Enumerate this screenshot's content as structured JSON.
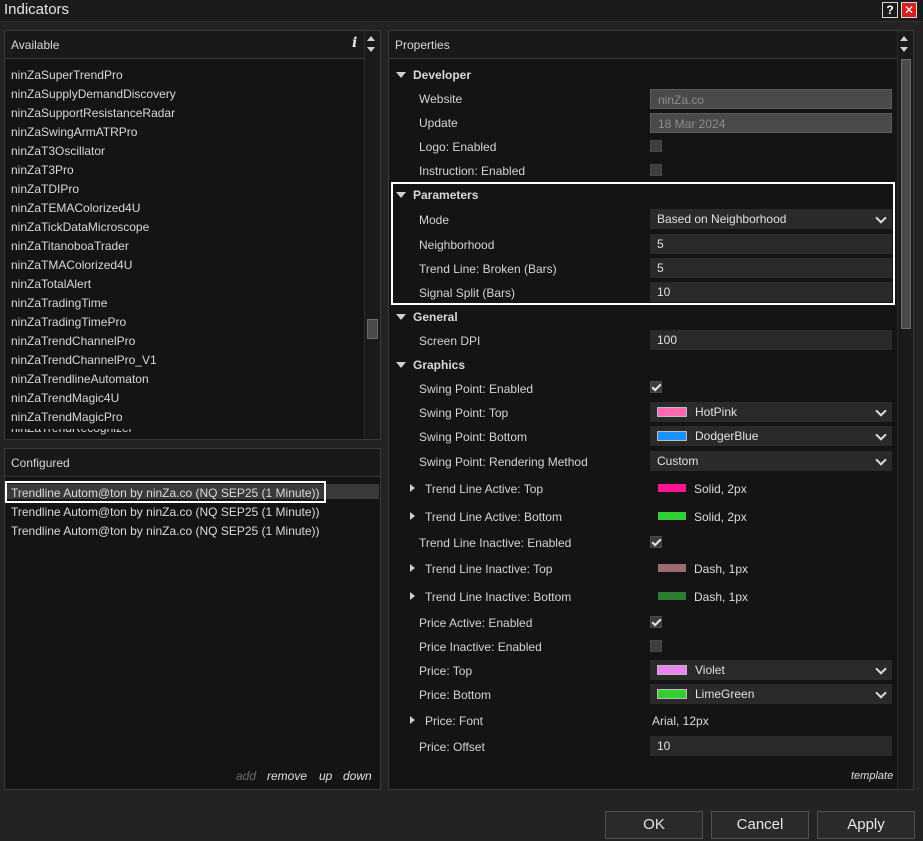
{
  "window": {
    "title": "Indicators",
    "help_label": "?",
    "close_label": "✕"
  },
  "available": {
    "header": "Available",
    "info_glyph": "i",
    "items": [
      "ninZaSuperTrendPro",
      "ninZaSupplyDemandDiscovery",
      "ninZaSupportResistanceRadar",
      "ninZaSwingArmATRPro",
      "ninZaT3Oscillator",
      "ninZaT3Pro",
      "ninZaTDIPro",
      "ninZaTEMAColorized4U",
      "ninZaTickDataMicroscope",
      "ninZaTitanoboaTrader",
      "ninZaTMAColorized4U",
      "ninZaTotalAlert",
      "ninZaTradingTime",
      "ninZaTradingTimePro",
      "ninZaTrendChannelPro",
      "ninZaTrendChannelPro_V1",
      "ninZaTrendlineAutomaton",
      "ninZaTrendMagic4U",
      "ninZaTrendMagicPro"
    ]
  },
  "configured": {
    "header": "Configured",
    "items": [
      "Trendline Autom@ton by ninZa.co (NQ SEP25 (1 Minute))",
      "Trendline Autom@ton by ninZa.co (NQ SEP25 (1 Minute))",
      "Trendline Autom@ton by ninZa.co (NQ SEP25 (1 Minute))"
    ],
    "actions": {
      "add": "add",
      "remove": "remove",
      "up": "up",
      "down": "down"
    }
  },
  "properties": {
    "header": "Properties",
    "template_link": "template",
    "developer": {
      "title": "Developer",
      "website_label": "Website",
      "website_value": "ninZa.co",
      "update_label": "Update",
      "update_value": "18 Mar 2024",
      "logo_label": "Logo: Enabled",
      "logo_checked": false,
      "instruction_label": "Instruction: Enabled",
      "instruction_checked": false
    },
    "parameters": {
      "title": "Parameters",
      "mode_label": "Mode",
      "mode_value": "Based on Neighborhood",
      "neighborhood_label": "Neighborhood",
      "neighborhood_value": "5",
      "trend_broken_label": "Trend Line: Broken (Bars)",
      "trend_broken_value": "5",
      "signal_split_label": "Signal Split (Bars)",
      "signal_split_value": "10"
    },
    "general": {
      "title": "General",
      "dpi_label": "Screen DPI",
      "dpi_value": "100"
    },
    "graphics": {
      "title": "Graphics",
      "swing_enabled_label": "Swing Point: Enabled",
      "swing_enabled_checked": true,
      "swing_top_label": "Swing Point: Top",
      "swing_top_value": "HotPink",
      "swing_top_color": "#ff69b4",
      "swing_bottom_label": "Swing Point: Bottom",
      "swing_bottom_value": "DodgerBlue",
      "swing_bottom_color": "#1e90ff",
      "swing_render_label": "Swing Point: Rendering Method",
      "swing_render_value": "Custom",
      "tl_active_top_label": "Trend Line Active: Top",
      "tl_active_top_value": "Solid, 2px",
      "tl_active_top_color": "#ff1493",
      "tl_active_bottom_label": "Trend Line Active: Bottom",
      "tl_active_bottom_value": "Solid, 2px",
      "tl_active_bottom_color": "#32cd32",
      "tl_inactive_enabled_label": "Trend Line Inactive: Enabled",
      "tl_inactive_enabled_checked": true,
      "tl_inactive_top_label": "Trend Line Inactive: Top",
      "tl_inactive_top_value": "Dash, 1px",
      "tl_inactive_top_color": "#9e6b73",
      "tl_inactive_bottom_label": "Trend Line Inactive: Bottom",
      "tl_inactive_bottom_value": "Dash, 1px",
      "tl_inactive_bottom_color": "#2e7d32",
      "price_active_label": "Price Active: Enabled",
      "price_active_checked": true,
      "price_inactive_label": "Price Inactive: Enabled",
      "price_inactive_checked": false,
      "price_top_label": "Price: Top",
      "price_top_value": "Violet",
      "price_top_color": "#ee82ee",
      "price_bottom_label": "Price: Bottom",
      "price_bottom_value": "LimeGreen",
      "price_bottom_color": "#32cd32",
      "price_font_label": "Price: Font",
      "price_font_value": "Arial, 12px",
      "price_offset_label": "Price: Offset",
      "price_offset_value": "10"
    }
  },
  "buttons": {
    "ok": "OK",
    "cancel": "Cancel",
    "apply": "Apply"
  }
}
